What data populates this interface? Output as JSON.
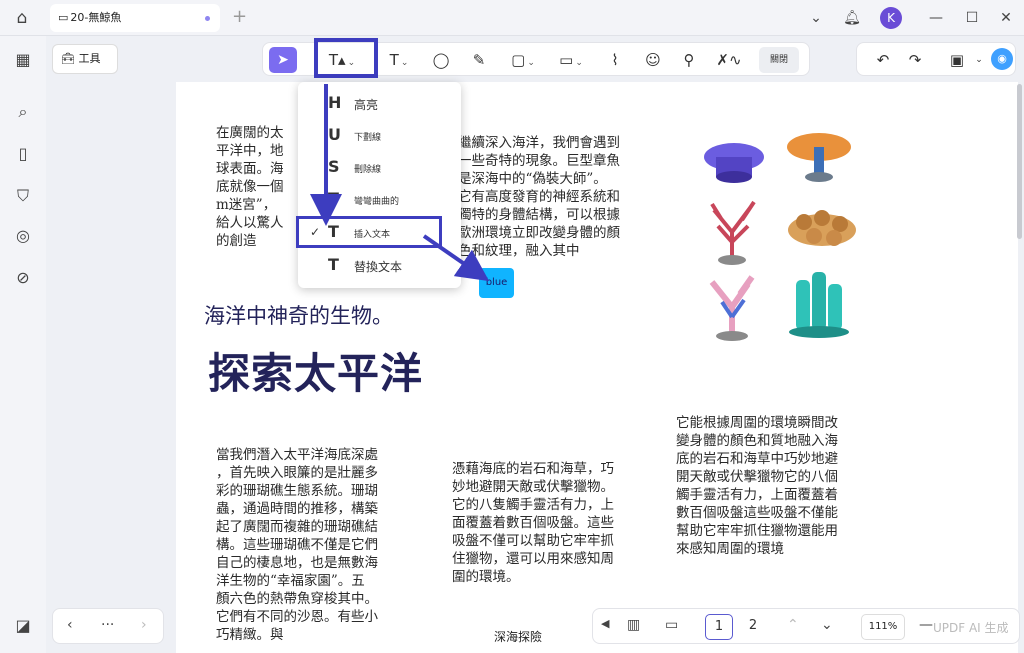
{
  "tab": {
    "title": "20-無鯨魚"
  },
  "toolbar": {
    "toolbox_label": "工具",
    "close_label": "關閉"
  },
  "menu": {
    "items": [
      {
        "icon": "H",
        "label": "高亮"
      },
      {
        "icon": "U",
        "label": "下劃線"
      },
      {
        "icon": "S",
        "label": "刪除線"
      },
      {
        "icon": "T",
        "label": "彎彎曲曲的"
      },
      {
        "icon": "T",
        "label": "插入文本",
        "checked": "✓"
      },
      {
        "icon": "T",
        "label": "替換文本"
      }
    ],
    "annotation_chip": "blue"
  },
  "document": {
    "col1_top": [
      "在廣闊的太",
      "平洋中，地",
      "球表面。海",
      "底就像一個",
      "m迷宮”，",
      "給人以驚人",
      "的創造"
    ],
    "col2_top": [
      "繼續深入海洋，我們會遇到",
      "一些奇特的現象。巨型章魚",
      "是深海中的“偽裝大師”。",
      "它有高度發育的神經系統和",
      "獨特的身體結構，可以根據",
      "歐洲環境立即改變身體的顏",
      "色和紋理，融入其中"
    ],
    "heading1": "海洋中神奇的生物。",
    "heading2": "探索太平洋",
    "col1_bottom": [
      "當我們潛入太平洋海底深處",
      "，首先映入眼簾的是壯麗多",
      "彩的珊瑚礁生態系統。珊瑚",
      "蟲，通過時間的推移，構築",
      "起了廣闊而複雜的珊瑚礁結",
      "構。這些珊瑚礁不僅是它們",
      "自己的棲息地，也是無數海",
      "洋生物的“幸福家園”。五",
      "顏六色的熱帶魚穿梭其中。",
      "它們有不同的沙恩。有些小",
      "巧精緻。與"
    ],
    "col2_bottom": [
      "憑藉海底的岩石和海草，巧",
      "妙地避開天敵或伏擊獵物。",
      "它的八隻觸手靈活有力，上",
      "面覆蓋着數百個吸盤。這些",
      "吸盤不僅可以幫助它牢牢抓",
      "住獵物，還可以用來感知周",
      "圍的環境。"
    ],
    "col3_bottom": [
      "它能根據周圍的環境瞬間改",
      "變身體的顏色和質地融入海",
      "底的岩石和海草中巧妙地避",
      "開天敵或伏擊獵物它的八個",
      "觸手靈活有力，上面覆蓋着",
      "數百個吸盤這些吸盤不僅能",
      "幫助它牢牢抓住獵物還能用",
      "來感知周圍的環境"
    ],
    "caption": "深海探險"
  },
  "pagination": {
    "page1": "1",
    "page2": "2",
    "zoom": "111%",
    "ai_label": "UPDF AI 生成"
  }
}
